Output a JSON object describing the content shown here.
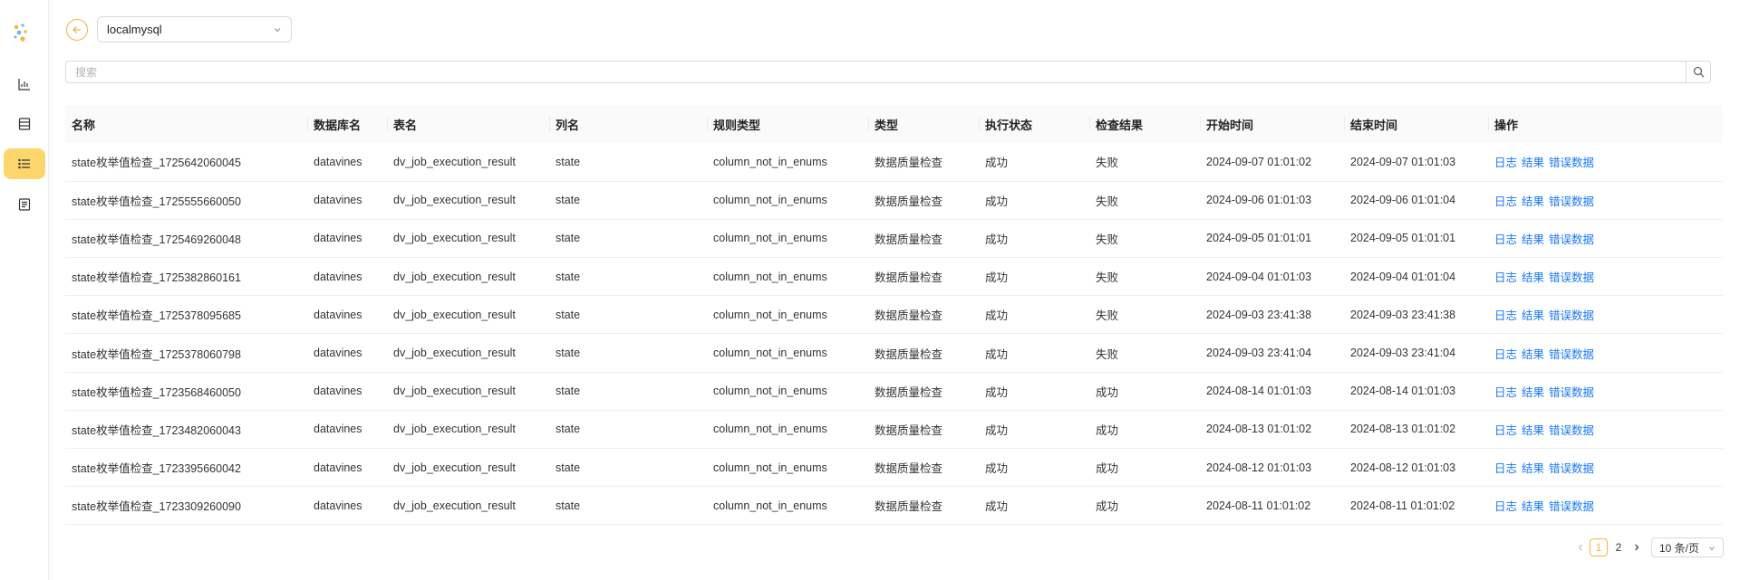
{
  "header": {
    "datasource": "localmysql"
  },
  "search": {
    "placeholder": "搜索"
  },
  "table": {
    "columns": [
      "名称",
      "数据库名",
      "表名",
      "列名",
      "规则类型",
      "类型",
      "执行状态",
      "检查结果",
      "开始时间",
      "结束时间",
      "操作"
    ],
    "rows": [
      [
        "state枚举值检查_1725642060045",
        "datavines",
        "dv_job_execution_result",
        "state",
        "column_not_in_enums",
        "数据质量检查",
        "成功",
        "失败",
        "2024-09-07 01:01:02",
        "2024-09-07 01:01:03"
      ],
      [
        "state枚举值检查_1725555660050",
        "datavines",
        "dv_job_execution_result",
        "state",
        "column_not_in_enums",
        "数据质量检查",
        "成功",
        "失败",
        "2024-09-06 01:01:03",
        "2024-09-06 01:01:04"
      ],
      [
        "state枚举值检查_1725469260048",
        "datavines",
        "dv_job_execution_result",
        "state",
        "column_not_in_enums",
        "数据质量检查",
        "成功",
        "失败",
        "2024-09-05 01:01:01",
        "2024-09-05 01:01:01"
      ],
      [
        "state枚举值检查_1725382860161",
        "datavines",
        "dv_job_execution_result",
        "state",
        "column_not_in_enums",
        "数据质量检查",
        "成功",
        "失败",
        "2024-09-04 01:01:03",
        "2024-09-04 01:01:04"
      ],
      [
        "state枚举值检查_1725378095685",
        "datavines",
        "dv_job_execution_result",
        "state",
        "column_not_in_enums",
        "数据质量检查",
        "成功",
        "失败",
        "2024-09-03 23:41:38",
        "2024-09-03 23:41:38"
      ],
      [
        "state枚举值检查_1725378060798",
        "datavines",
        "dv_job_execution_result",
        "state",
        "column_not_in_enums",
        "数据质量检查",
        "成功",
        "失败",
        "2024-09-03 23:41:04",
        "2024-09-03 23:41:04"
      ],
      [
        "state枚举值检查_1723568460050",
        "datavines",
        "dv_job_execution_result",
        "state",
        "column_not_in_enums",
        "数据质量检查",
        "成功",
        "成功",
        "2024-08-14 01:01:03",
        "2024-08-14 01:01:03"
      ],
      [
        "state枚举值检查_1723482060043",
        "datavines",
        "dv_job_execution_result",
        "state",
        "column_not_in_enums",
        "数据质量检查",
        "成功",
        "成功",
        "2024-08-13 01:01:02",
        "2024-08-13 01:01:02"
      ],
      [
        "state枚举值检查_1723395660042",
        "datavines",
        "dv_job_execution_result",
        "state",
        "column_not_in_enums",
        "数据质量检查",
        "成功",
        "成功",
        "2024-08-12 01:01:03",
        "2024-08-12 01:01:03"
      ],
      [
        "state枚举值检查_1723309260090",
        "datavines",
        "dv_job_execution_result",
        "state",
        "column_not_in_enums",
        "数据质量检查",
        "成功",
        "成功",
        "2024-08-11 01:01:02",
        "2024-08-11 01:01:02"
      ]
    ],
    "actions": [
      "日志",
      "结果",
      "错误数据"
    ]
  },
  "pagination": {
    "pages": [
      "1",
      "2"
    ],
    "current": "1",
    "page_size": "10 条/页"
  },
  "theme": {
    "accent": "#f2b441",
    "link": "#1677ff",
    "active_nav": "#fdd66b"
  },
  "icons": {
    "nav": [
      "chart-icon",
      "table-icon",
      "list-icon",
      "document-icon"
    ],
    "back": "arrow-left-icon",
    "search": "search-icon"
  }
}
